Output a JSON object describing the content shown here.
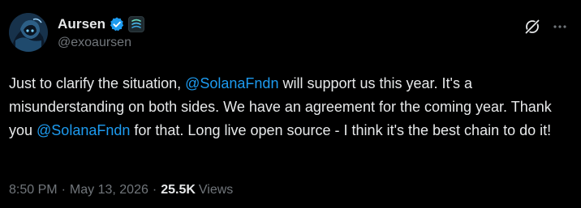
{
  "author": {
    "display_name": "Aursen",
    "handle": "@exoaursen",
    "verified_icon": "verified-badge-icon",
    "affiliation_icon": "affiliate-badge-icon",
    "verified_color": "#1d9bf0"
  },
  "header": {
    "grok_icon": "grok-icon",
    "more_icon": "more-horizontal-icon"
  },
  "tweet": {
    "segments": [
      {
        "text": "Just to clarify the situation, ",
        "mention": false
      },
      {
        "text": "@SolanaFndn",
        "mention": true
      },
      {
        "text": " will support us this year. It's a misunderstanding on both sides. We have an agreement for the coming year. Thank you ",
        "mention": false
      },
      {
        "text": "@SolanaFndn",
        "mention": true
      },
      {
        "text": " for that. Long live open source - I think it's the best chain to do it!",
        "mention": false
      }
    ],
    "mention_color": "#1d9bf0"
  },
  "meta": {
    "time": "8:50 PM",
    "separator": "·",
    "date": "May 13, 2026",
    "views_count": "25.5K",
    "views_label": "Views"
  }
}
